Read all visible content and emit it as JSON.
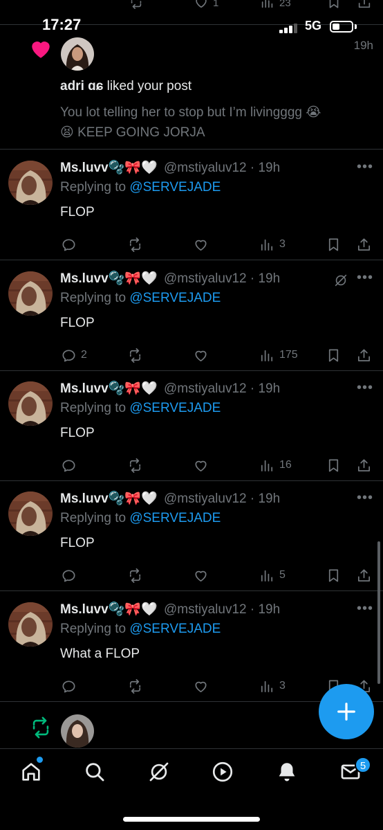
{
  "top_strip": {
    "like_count": "1",
    "view_count": "23"
  },
  "status_bar": {
    "time": "17:27",
    "network": "5G"
  },
  "notification": {
    "user": "adri ɑɕ",
    "action": " liked your post",
    "time": "19h",
    "quote_line1": "You lot telling her to stop but I’m livingggg 😭",
    "quote_line2": "😫 KEEP GOING JORJA"
  },
  "tweets": [
    {
      "name": "Ms.luvv",
      "emojis": "🫧🎀🤍",
      "handle": "@mstiyaluv12 · 19h",
      "reply_prefix": "Replying to ",
      "mention": "@SERVEJADE",
      "text": "FLOP",
      "reply_count": "",
      "views": "3"
    },
    {
      "name": "Ms.luvv",
      "emojis": "🫧🎀🤍",
      "handle": "@mstiyaluv12 · 19h",
      "reply_prefix": "Replying to ",
      "mention": "@SERVEJADE",
      "text": "FLOP",
      "reply_count": "2",
      "views": "175"
    },
    {
      "name": "Ms.luvv",
      "emojis": "🫧🎀🤍",
      "handle": "@mstiyaluv12 · 19h",
      "reply_prefix": "Replying to ",
      "mention": "@SERVEJADE",
      "text": "FLOP",
      "reply_count": "",
      "views": "16"
    },
    {
      "name": "Ms.luvv",
      "emojis": "🫧🎀🤍",
      "handle": "@mstiyaluv12 · 19h",
      "reply_prefix": "Replying to ",
      "mention": "@SERVEJADE",
      "text": "FLOP",
      "reply_count": "",
      "views": "5"
    },
    {
      "name": "Ms.luvv",
      "emojis": "🫧🎀🤍",
      "handle": "@mstiyaluv12 · 19h",
      "reply_prefix": "Replying to ",
      "mention": "@SERVEJADE",
      "text": "What a FLOP",
      "reply_count": "",
      "views": "3"
    }
  ],
  "more_glyph": "•••",
  "tab_bar": {
    "messages_badge": "5"
  },
  "colors": {
    "accent": "#1d9bf0",
    "like": "#f91880",
    "retweet": "#00ba7c",
    "muted": "#71767b",
    "background": "#000000"
  },
  "icons": [
    "heart-icon",
    "reply-icon",
    "retweet-icon",
    "like-icon",
    "views-icon",
    "bookmark-icon",
    "share-icon",
    "more-icon",
    "grok-icon",
    "home-icon",
    "search-icon",
    "grok-tab-icon",
    "video-icon",
    "notifications-icon",
    "messages-icon",
    "compose-icon"
  ]
}
